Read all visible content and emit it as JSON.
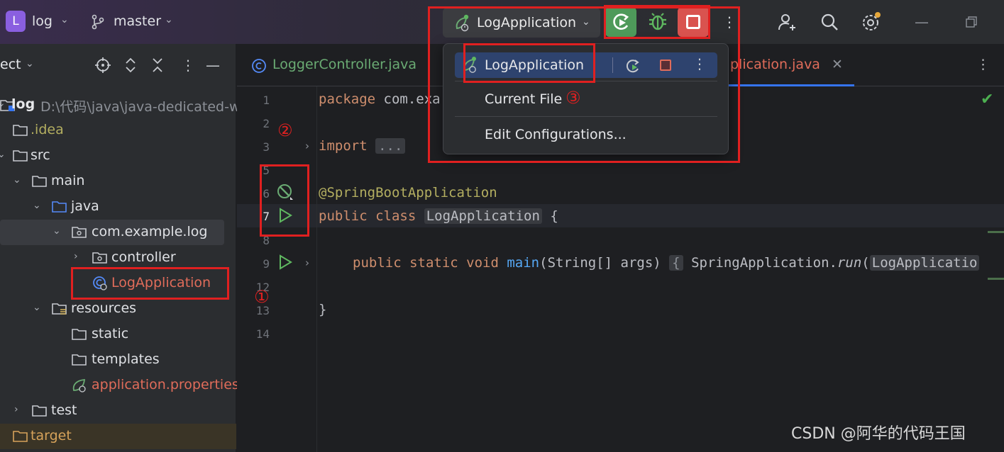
{
  "titlebar": {
    "project_badge": "L",
    "project_name": "log",
    "branch": "master",
    "run_config": "LogApplication",
    "icons": [
      "branch-icon",
      "rerun-icon",
      "debug-icon",
      "stop-icon",
      "more-icon",
      "add-user-icon",
      "search-icon",
      "settings-icon",
      "minimize-icon",
      "restore-icon"
    ],
    "colors": {
      "rerun": "#4e9a5a",
      "stop": "#d9534f",
      "badge": "#8a5fe0"
    }
  },
  "sidebar": {
    "title": "ect",
    "tree": [
      {
        "label": "log",
        "path": "D:\\代码\\java\\java-dedicated-w",
        "kind": "module"
      },
      {
        "label": ".idea",
        "kind": "folder"
      },
      {
        "label": "src",
        "kind": "folder"
      },
      {
        "label": "main",
        "kind": "folder"
      },
      {
        "label": "java",
        "kind": "source-folder"
      },
      {
        "label": "com.example.log",
        "kind": "package"
      },
      {
        "label": "controller",
        "kind": "package"
      },
      {
        "label": "LogApplication",
        "kind": "spring-class"
      },
      {
        "label": "resources",
        "kind": "resources-folder"
      },
      {
        "label": "static",
        "kind": "folder"
      },
      {
        "label": "templates",
        "kind": "folder"
      },
      {
        "label": "application.properties",
        "kind": "spring-properties"
      },
      {
        "label": "test",
        "kind": "folder"
      },
      {
        "label": "target",
        "kind": "excluded-folder"
      }
    ]
  },
  "editor": {
    "tabs": [
      {
        "label": "LoggerController.java"
      },
      {
        "label": "plication.java"
      }
    ],
    "line_numbers": [
      "1",
      "2",
      "3",
      "5",
      "6",
      "7",
      "8",
      "9",
      "12",
      "13",
      "14"
    ],
    "code": {
      "l1_kw": "package",
      "l1_rest": " com.exa",
      "l3_kw": "import",
      "l3_fold": "...",
      "l6": "@SpringBootApplication",
      "l7_kw": "public class",
      "l7_name": "LogApplication",
      "l7_brace": " {",
      "l9_kw": "public static void",
      "l9_fn": "main",
      "l9_args": "(String[] args)",
      "l9_fold": "{",
      "l9_call": " SpringApplication.",
      "l9_run": "run",
      "l9_tail": "(",
      "l9_arg_hl": "LogApplicatio",
      "l13": "}"
    }
  },
  "popup": {
    "items": [
      {
        "label": "LogApplication"
      },
      {
        "label": "Current File"
      },
      {
        "label": "Edit Configurations..."
      }
    ]
  },
  "annotations": {
    "n1": "①",
    "n2": "②",
    "n3": "③"
  },
  "watermark": "CSDN @阿华的代码王国"
}
